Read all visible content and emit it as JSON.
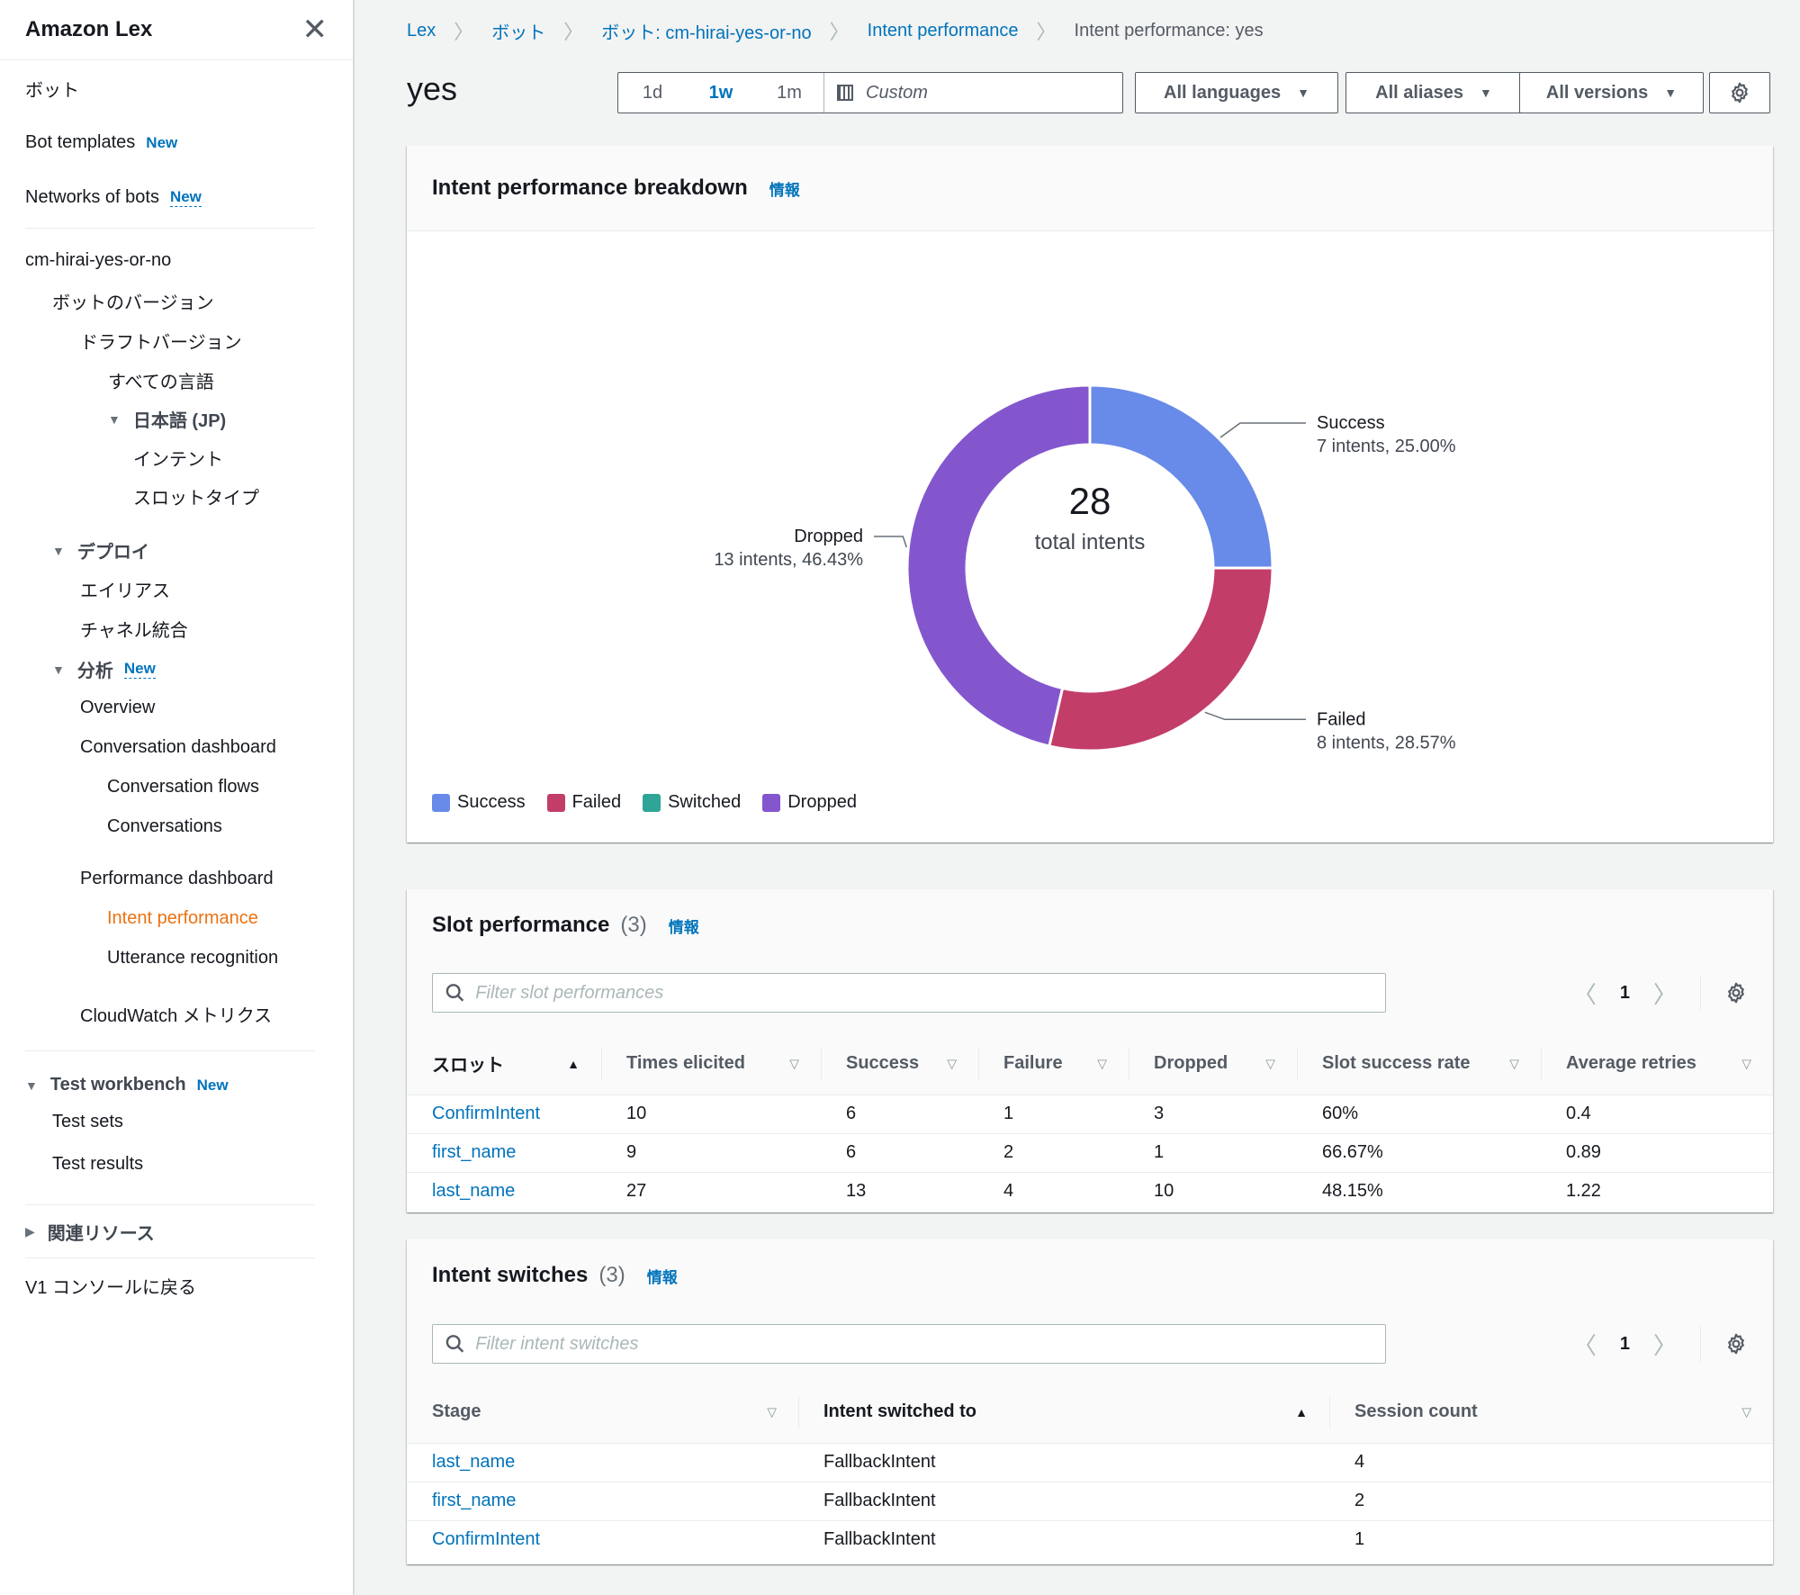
{
  "sidebar": {
    "title": "Amazon Lex",
    "items": {
      "bots": "ボット",
      "bot_templates": "Bot templates",
      "bot_templates_badge": "New",
      "networks": "Networks of bots",
      "networks_badge": "New",
      "bot_name": "cm-hirai-yes-or-no",
      "bot_versions": "ボットのバージョン",
      "draft_version": "ドラフトバージョン",
      "all_languages": "すべての言語",
      "japanese": "日本語 (JP)",
      "intents": "インテント",
      "slot_types": "スロットタイプ",
      "deploy": "デプロイ",
      "aliases": "エイリアス",
      "channels": "チャネル統合",
      "analytics": "分析",
      "analytics_badge": "New",
      "overview": "Overview",
      "conversation_dashboard": "Conversation dashboard",
      "conversation_flows": "Conversation flows",
      "conversations": "Conversations",
      "performance_dashboard": "Performance dashboard",
      "intent_performance": "Intent performance",
      "utterance_recognition": "Utterance recognition",
      "cloudwatch": "CloudWatch メトリクス",
      "test_workbench": "Test workbench",
      "test_workbench_badge": "New",
      "test_sets": "Test sets",
      "test_results": "Test results",
      "related_resources": "関連リソース",
      "v1_console": "V1 コンソールに戻る"
    }
  },
  "breadcrumb": [
    "Lex",
    "ボット",
    "ボット: cm-hirai-yes-or-no",
    "Intent performance",
    "Intent performance: yes"
  ],
  "header": {
    "title": "yes",
    "range_options": [
      "1d",
      "1w",
      "1m"
    ],
    "range_selected": "1w",
    "custom_label": "Custom",
    "languages": "All languages",
    "aliases": "All aliases",
    "versions": "All versions"
  },
  "breakdown": {
    "title": "Intent performance breakdown",
    "info": "情報",
    "total": "28",
    "total_label": "total intents"
  },
  "chart_data": {
    "type": "pie",
    "donut": true,
    "title": "Intent performance breakdown",
    "center_value": 28,
    "center_label": "total intents",
    "legend_placement": "bottom-left",
    "categories": [
      "Success",
      "Failed",
      "Switched",
      "Dropped"
    ],
    "values": [
      7,
      8,
      0,
      13
    ],
    "percentages": [
      25.0,
      28.57,
      0,
      46.43
    ],
    "colors": [
      "#688ae8",
      "#c33d69",
      "#2ea597",
      "#8456ce"
    ],
    "labels": [
      {
        "name": "Success",
        "detail": "7 intents, 25.00%"
      },
      {
        "name": "Failed",
        "detail": "8 intents, 28.57%"
      },
      {
        "name": "Dropped",
        "detail": "13 intents, 46.43%"
      }
    ]
  },
  "slot_performance": {
    "title": "Slot performance",
    "count": "(3)",
    "info": "情報",
    "filter_placeholder": "Filter slot performances",
    "page": "1",
    "columns": [
      "スロット",
      "Times elicited",
      "Success",
      "Failure",
      "Dropped",
      "Slot success rate",
      "Average retries"
    ],
    "rows": [
      [
        "ConfirmIntent",
        "10",
        "6",
        "1",
        "3",
        "60%",
        "0.4"
      ],
      [
        "first_name",
        "9",
        "6",
        "2",
        "1",
        "66.67%",
        "0.89"
      ],
      [
        "last_name",
        "27",
        "13",
        "4",
        "10",
        "48.15%",
        "1.22"
      ]
    ]
  },
  "intent_switches": {
    "title": "Intent switches",
    "count": "(3)",
    "info": "情報",
    "filter_placeholder": "Filter intent switches",
    "page": "1",
    "columns": [
      "Stage",
      "Intent switched to",
      "Session count"
    ],
    "rows": [
      [
        "last_name",
        "FallbackIntent",
        "4"
      ],
      [
        "first_name",
        "FallbackIntent",
        "2"
      ],
      [
        "ConfirmIntent",
        "FallbackIntent",
        "1"
      ]
    ]
  }
}
